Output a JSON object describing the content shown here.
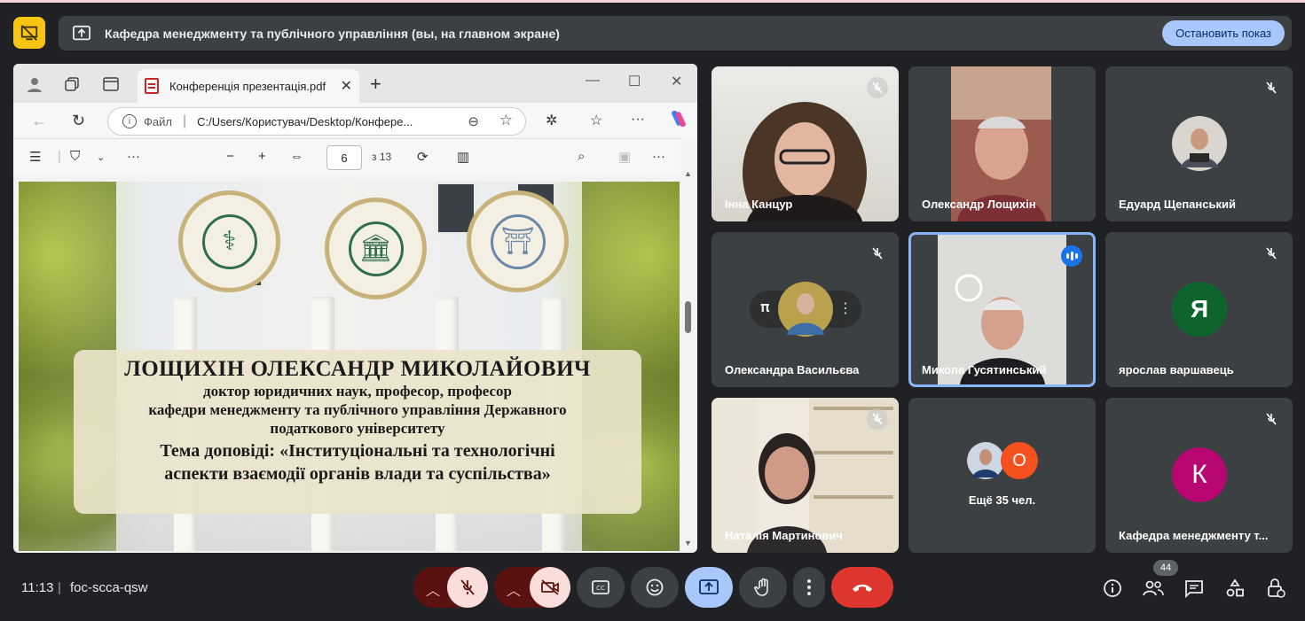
{
  "banner": {
    "text": "Кафедра менеджменту та публічного управління (вы, на главном экране)",
    "stop_button": "Остановить показ"
  },
  "browser": {
    "tab_title": "Конференція презентація.pdf",
    "address_label": "Файл",
    "url": "C:/Users/Користувач/Desktop/Конфере...",
    "pdf_page": "6",
    "pdf_total": "з 13"
  },
  "slide": {
    "name": "ЛОЩИХІН ОЛЕКСАНДР МИКОЛАЙОВИЧ",
    "line1": "доктор юридичних наук, професор, професор",
    "line2": "кафедри менеджменту та публічного управління Державного",
    "line3": "податкового університету",
    "topic1": "Тема доповіді: «Інституціональні та технологічні",
    "topic2": "аспекти взаємодії органів влади та суспільства»"
  },
  "participants": [
    {
      "name": "Інна Канцур"
    },
    {
      "name": "Олександр Лощихін"
    },
    {
      "name": "Едуард Щепанський"
    },
    {
      "name": "Олександра Васильєва"
    },
    {
      "name": "Микола Гусятинський"
    },
    {
      "name": "ярослав варшавець",
      "initial": "Я"
    },
    {
      "name": "Наталія Мартинович"
    },
    {
      "name": "Ещё 35 чел.",
      "count_initial": "О"
    },
    {
      "name": "Кафедра менеджменту т...",
      "initial": "К"
    }
  ],
  "bottom": {
    "time": "11:13",
    "separator": "|",
    "meeting_code": "foc-scca-qsw",
    "participant_count": "44"
  },
  "colors": {
    "background": "#202124",
    "tile": "#3c4043",
    "present_accent": "#f9c513",
    "stop_button": "#a8c7fa",
    "end_call": "#dc362e",
    "avatar_ya": "#0d652d",
    "avatar_k": "#b80672",
    "avatar_o": "#f4511e"
  }
}
